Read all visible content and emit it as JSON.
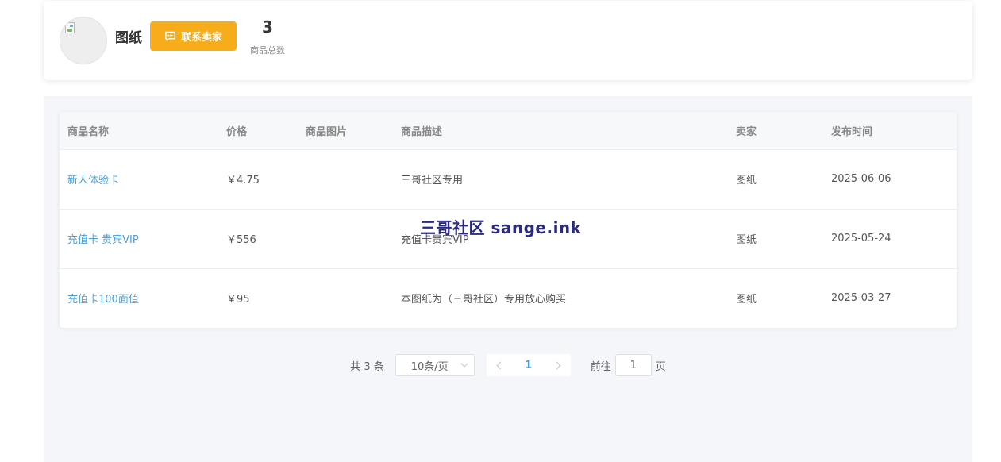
{
  "seller": {
    "name": "图纸",
    "contact_label": "联系卖家",
    "stat_value": "3",
    "stat_label": "商品总数"
  },
  "table": {
    "headers": [
      "商品名称",
      "价格",
      "商品图片",
      "商品描述",
      "卖家",
      "发布时间"
    ],
    "rows": [
      {
        "name": "新人体验卡",
        "price": "￥4.75",
        "image": "",
        "description": "三哥社区专用",
        "seller": "图纸",
        "date": "2025-06-06"
      },
      {
        "name": "充值卡 贵宾VIP",
        "price": "￥556",
        "image": "",
        "description": "充值卡贵宾VIP",
        "seller": "图纸",
        "date": "2025-05-24"
      },
      {
        "name": "充值卡100面值",
        "price": "￥95",
        "image": "",
        "description": "本图纸为（三哥社区）专用放心购买",
        "seller": "图纸",
        "date": "2025-03-27"
      }
    ]
  },
  "watermark": "三哥社区 sange.ink",
  "pagination": {
    "total_label": "共 3 条",
    "page_size": "10条/页",
    "current_page": "1",
    "goto_label": "前往",
    "goto_value": "1",
    "page_unit": "页"
  },
  "colors": {
    "accent_button": "#f7ac19",
    "link": "#4a9fd5",
    "pagination_active": "#409eff",
    "panel_bg": "#f5f6fa"
  }
}
